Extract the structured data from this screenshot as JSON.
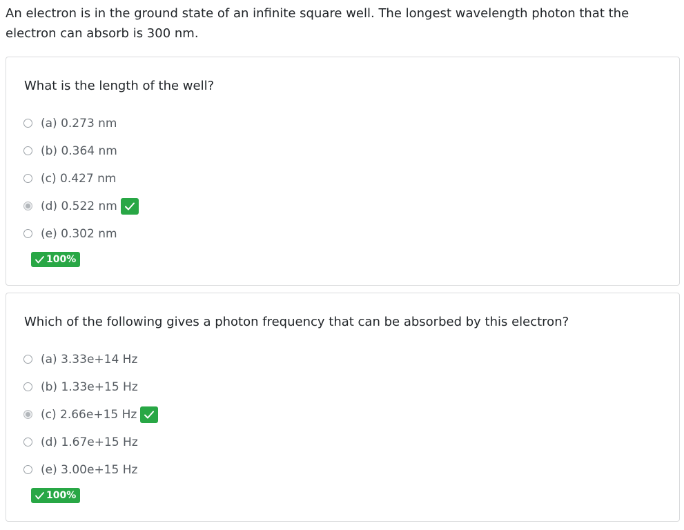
{
  "intro": "An electron is in the ground state of an infinite square well. The longest wavelength photon that the electron can absorb is 300 nm.",
  "questions": [
    {
      "prompt": "What is the length of the well?",
      "options": [
        {
          "label": "(a) 0.273 nm",
          "selected": false,
          "correct": false
        },
        {
          "label": "(b) 0.364 nm",
          "selected": false,
          "correct": false
        },
        {
          "label": "(c) 0.427 nm",
          "selected": false,
          "correct": false
        },
        {
          "label": "(d) 0.522 nm",
          "selected": true,
          "correct": true
        },
        {
          "label": "(e) 0.302 nm",
          "selected": false,
          "correct": false
        }
      ],
      "score": "100%"
    },
    {
      "prompt": "Which of the following gives a photon frequency that can be absorbed by this electron?",
      "options": [
        {
          "label": "(a) 3.33e+14 Hz",
          "selected": false,
          "correct": false
        },
        {
          "label": "(b) 1.33e+15 Hz",
          "selected": false,
          "correct": false
        },
        {
          "label": "(c) 2.66e+15 Hz",
          "selected": true,
          "correct": true
        },
        {
          "label": "(d) 1.67e+15 Hz",
          "selected": false,
          "correct": false
        },
        {
          "label": "(e) 3.00e+15 Hz",
          "selected": false,
          "correct": false
        }
      ],
      "score": "100%"
    }
  ],
  "colors": {
    "success": "#28a745",
    "text": "#212529",
    "option_text": "#555b61",
    "card_border": "#d9dadc"
  },
  "icons": {
    "correct": "checkmark-icon",
    "radio": "radio-icon"
  }
}
